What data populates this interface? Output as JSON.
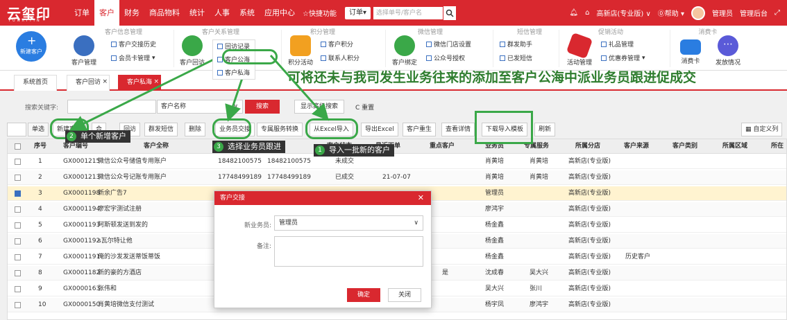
{
  "app": {
    "logo": "云玺印",
    "logo_sub": "YUNXIYIN"
  },
  "nav": {
    "items": [
      "订单",
      "客户",
      "财务",
      "商品物料",
      "统计",
      "人事",
      "系统",
      "应用中心"
    ],
    "quick": "☆快捷功能",
    "order_select": "订单▾",
    "search_placeholder": "选择单号/客户名",
    "store": "高新店(专业版) ∨",
    "help": "⓪帮助 ▾",
    "admin_user": "管理员",
    "admin_link": "管理后台"
  },
  "ribbon": {
    "groups": [
      "客户信息管理",
      "客户关系管理",
      "积分管理",
      "微信管理",
      "短信管理",
      "促销活动",
      "消费卡"
    ],
    "new_customer": "新建客户",
    "customer_mgmt": "客户管理",
    "customer_history": "客户交接历史",
    "member_card": "会员卡管理",
    "customer_visit": "客户回访",
    "visit_record": "回访记录",
    "public_sea": "客户公海",
    "private_sea": "客户私海",
    "points_activity": "积分活动",
    "customer_points": "客户积分",
    "contact_points": "联系人积分",
    "customer_bind": "客户绑定",
    "wechat_store": "微信门店设置",
    "official_account": "公众号授权",
    "sms_helper": "群发助手",
    "sent_sms": "已发短信",
    "activity_mgmt": "活动管理",
    "gift_mgmt": "礼品管理",
    "coupon_mgmt": "优惠券管理",
    "consume_card": "消费卡",
    "issue_status": "发放情况"
  },
  "tabs": [
    "系统首页",
    "客户回访",
    "客户私海"
  ],
  "overlay_text": "可将还未与我司发生业务往来的添加至客户公海中派业务员跟进促成交",
  "search": {
    "keyword_label": "搜索关键字:",
    "field_select": "客户名称",
    "search_btn": "搜索",
    "advanced_btn": "显示高级搜索",
    "reset_btn": "C 重置"
  },
  "toolbar": {
    "single_select": "单选",
    "new_customer": "新建客户",
    "more": "合",
    "visit": "回访",
    "mass_sms": "群发短信",
    "delete": "删除",
    "salesman_handover": "业务员交接",
    "special_service": "专属服务转换",
    "import_excel": "从Excel导入",
    "export_excel": "导出Excel",
    "customer_rebirth": "客户重生",
    "view_detail": "查看详情",
    "download_template": "下载导入模板",
    "refresh": "刷新",
    "customize": "自定义列"
  },
  "annotations": {
    "a1_num": "1",
    "a1": "导入一批新的客户",
    "a2_num": "2",
    "a2": "单个新增客户",
    "a3_num": "3",
    "a3": "选择业务员跟进"
  },
  "table": {
    "headers": [
      "序号",
      "客户编号",
      "客户全称",
      "话",
      "客户状态",
      "最近下单",
      "重点客户",
      "业务员",
      "专属服务",
      "所属分店",
      "客户来源",
      "客户类别",
      "所属区域",
      "所在"
    ],
    "rows": [
      {
        "no": "1",
        "code": "GX0001215",
        "name": "微信公众号储值专用账户",
        "phone1": "18482100575",
        "phone2": "18482100575",
        "status": "未成交",
        "date": "",
        "key": "",
        "salesman": "肖黄培",
        "service": "肖黄培",
        "store": "高新店(专业版)",
        "source": "",
        "checked": false
      },
      {
        "no": "2",
        "code": "GX0001213",
        "name": "微信公众号记账专用账户",
        "phone1": "17748499189",
        "phone2": "17748499189",
        "status": "已成交",
        "date": "21-07-07",
        "key": "",
        "salesman": "肖黄培",
        "service": "肖黄培",
        "store": "高新店(专业版)",
        "source": "",
        "checked": false
      },
      {
        "no": "3",
        "code": "GX0001198",
        "name": "新余广告7",
        "phone1": "",
        "phone2": "",
        "status": "",
        "date": "",
        "key": "",
        "salesman": "管理员",
        "service": "",
        "store": "高新店(专业版)",
        "source": "",
        "checked": true
      },
      {
        "no": "4",
        "code": "GX0001194",
        "name": "廖宏宇测试注册",
        "phone1": "",
        "phone2": "",
        "status": "",
        "date": "",
        "key": "",
        "salesman": "廖鸿宇",
        "service": "",
        "store": "高新店(专业版)",
        "source": "",
        "checked": false
      },
      {
        "no": "5",
        "code": "GX0001193",
        "name": "阿斯顿发送到发的",
        "phone1": "",
        "phone2": "",
        "status": "",
        "date": "",
        "key": "",
        "salesman": "杨金鑫",
        "service": "",
        "store": "高新店(专业版)",
        "source": "",
        "checked": false
      },
      {
        "no": "6",
        "code": "GX0001192",
        "name": "s瓦尔特让他",
        "phone1": "",
        "phone2": "",
        "status": "",
        "date": "",
        "key": "",
        "salesman": "杨金鑫",
        "service": "",
        "store": "高新店(专业版)",
        "source": "",
        "checked": false
      },
      {
        "no": "7",
        "code": "GX0001191",
        "name": "俺的沙发发送蒂饭蒂饭",
        "phone1": "",
        "phone2": "",
        "status": "",
        "date": "",
        "key": "",
        "salesman": "杨金鑫",
        "service": "",
        "store": "高新店(专业版)",
        "source": "历史客户",
        "checked": false
      },
      {
        "no": "8",
        "code": "GX0001182",
        "name": "新的豪的方酒店",
        "phone1": "",
        "phone2": "",
        "status": "",
        "date": "",
        "key": "是",
        "salesman": "沈成春",
        "service": "吴大兴",
        "store": "高新店(专业版)",
        "source": "",
        "checked": false
      },
      {
        "no": "9",
        "code": "GX0000163",
        "name": "张伟和",
        "phone1": "",
        "phone2": "",
        "status": "",
        "date": "",
        "key": "",
        "salesman": "吴大兴",
        "service": "张川",
        "store": "高新店(专业版)",
        "source": "",
        "checked": false
      },
      {
        "no": "10",
        "code": "GX0000150",
        "name": "肖黄培微信支付测试",
        "phone1": "",
        "phone2": "",
        "status": "",
        "date": "",
        "key": "",
        "salesman": "杨宇凤",
        "service": "廖鸿宇",
        "store": "高新店(专业版)",
        "source": "",
        "checked": false
      }
    ]
  },
  "modal": {
    "title": "客户交接",
    "close": "✕",
    "new_salesman_label": "新业务员:",
    "new_salesman_value": "管理员",
    "remark_label": "备注:",
    "ok": "确定",
    "cancel": "关闭"
  },
  "colors": {
    "brand_red": "#d9282f",
    "annotation_green": "#3aa848",
    "overlay_text": "#2e7d2e"
  }
}
